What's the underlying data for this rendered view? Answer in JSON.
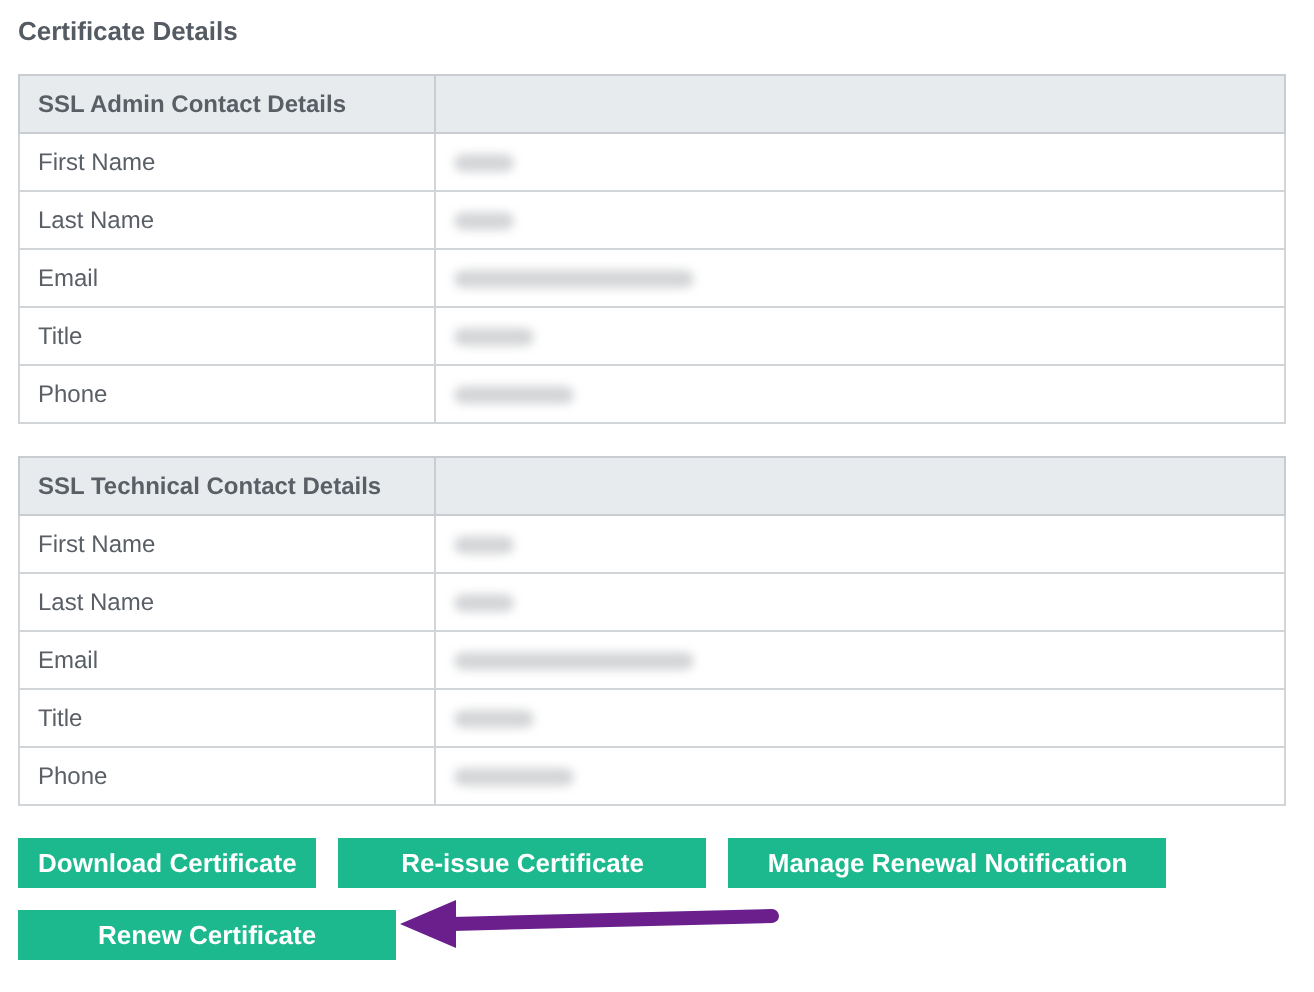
{
  "heading": "Certificate Details",
  "tables": [
    {
      "title": "SSL Admin Contact Details",
      "rows": [
        {
          "label": "First Name",
          "value_hidden": true
        },
        {
          "label": "Last Name",
          "value_hidden": true
        },
        {
          "label": "Email",
          "value_hidden": true
        },
        {
          "label": "Title",
          "value_hidden": true
        },
        {
          "label": "Phone",
          "value_hidden": true
        }
      ]
    },
    {
      "title": "SSL Technical Contact Details",
      "rows": [
        {
          "label": "First Name",
          "value_hidden": true
        },
        {
          "label": "Last Name",
          "value_hidden": true
        },
        {
          "label": "Email",
          "value_hidden": true
        },
        {
          "label": "Title",
          "value_hidden": true
        },
        {
          "label": "Phone",
          "value_hidden": true
        }
      ]
    }
  ],
  "buttons": [
    {
      "label": "Download Certificate"
    },
    {
      "label": "Re-issue Certificate"
    },
    {
      "label": "Manage Renewal Notification"
    },
    {
      "label": "Renew Certificate",
      "highlighted": true
    }
  ]
}
